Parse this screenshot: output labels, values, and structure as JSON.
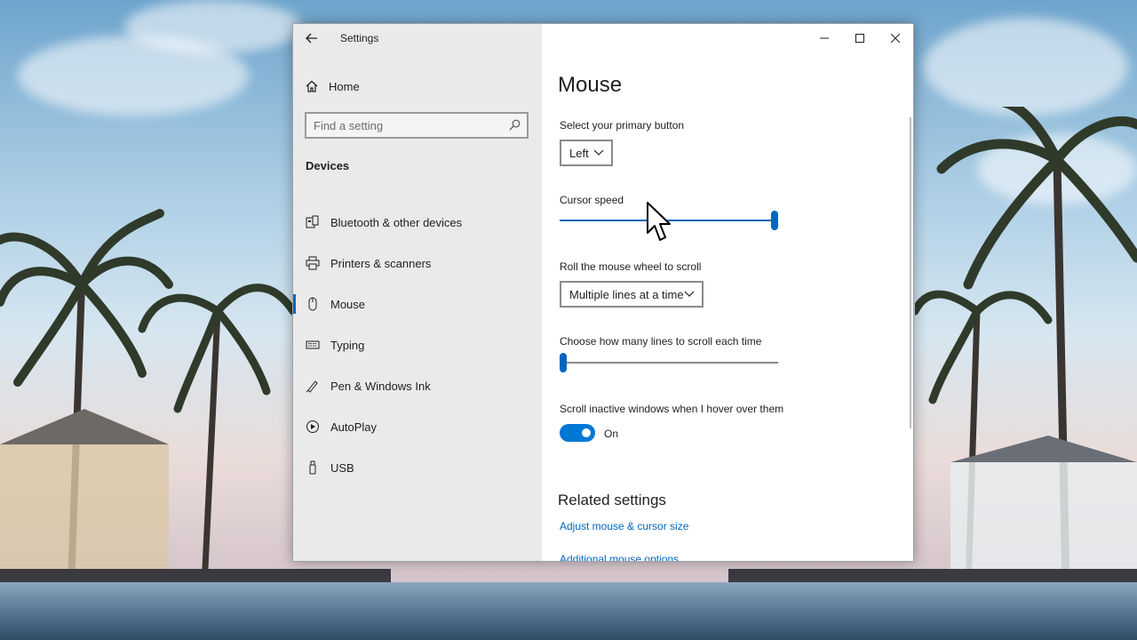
{
  "window": {
    "title": "Settings",
    "controls": {
      "minimize": "minimize",
      "maximize": "maximize",
      "close": "close"
    }
  },
  "nav": {
    "home_label": "Home",
    "search_placeholder": "Find a setting",
    "section_title": "Devices",
    "items": [
      {
        "label": "Bluetooth & other devices",
        "icon": "bluetooth-devices-icon"
      },
      {
        "label": "Printers & scanners",
        "icon": "printer-icon"
      },
      {
        "label": "Mouse",
        "icon": "mouse-icon",
        "active": true
      },
      {
        "label": "Typing",
        "icon": "keyboard-icon"
      },
      {
        "label": "Pen & Windows Ink",
        "icon": "pen-icon"
      },
      {
        "label": "AutoPlay",
        "icon": "autoplay-icon"
      },
      {
        "label": "USB",
        "icon": "usb-icon"
      }
    ]
  },
  "content": {
    "page_title": "Mouse",
    "primary_button": {
      "label": "Select your primary button",
      "value": "Left"
    },
    "cursor_speed": {
      "label": "Cursor speed",
      "level": 1.0
    },
    "wheel_scroll": {
      "label": "Roll the mouse wheel to scroll",
      "value": "Multiple lines at a time"
    },
    "lines_to_scroll": {
      "label": "Choose how many lines to scroll each time",
      "level": 0.0
    },
    "scroll_inactive": {
      "label": "Scroll inactive windows when I hover over them",
      "state": "On",
      "enabled": true
    },
    "related": {
      "title": "Related settings",
      "links": [
        "Adjust mouse & cursor size",
        "Additional mouse options"
      ]
    }
  },
  "colors": {
    "accent": "#0078d4",
    "link": "#0067c0",
    "nav_bg": "#eaeaea"
  }
}
